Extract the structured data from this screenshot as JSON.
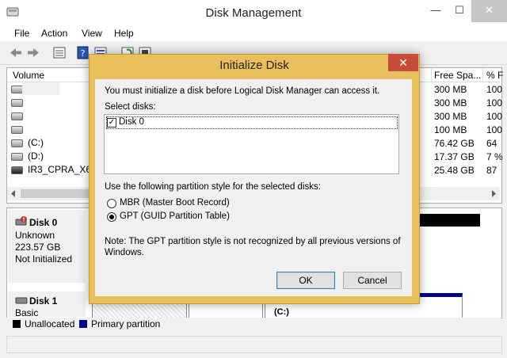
{
  "window": {
    "title": "Disk Management",
    "minimize": "—",
    "maximize": "☐",
    "close": "✕"
  },
  "menu": [
    "File",
    "Action",
    "View",
    "Help"
  ],
  "toolbar_icons": [
    "back-arrow-icon",
    "forward-arrow-icon",
    "properties-icon",
    "help-icon",
    "refresh-icon",
    "rescan-icon"
  ],
  "volume_list": {
    "columns": [
      "Volume",
      "Free Spa...",
      "% F"
    ],
    "rows": [
      {
        "volume": "",
        "free": "300 MB",
        "pct": "100"
      },
      {
        "volume": "",
        "free": "300 MB",
        "pct": "100"
      },
      {
        "volume": "",
        "free": "300 MB",
        "pct": "100"
      },
      {
        "volume": "",
        "free": "100 MB",
        "pct": "100"
      },
      {
        "volume": "(C:)",
        "free": "76.42 GB",
        "pct": "64"
      },
      {
        "volume": "(D:)",
        "free": "17.37 GB",
        "pct": "7 %"
      },
      {
        "volume": "IR3_CPRA_X6 (E",
        "free": "25.48 GB",
        "pct": "87"
      }
    ]
  },
  "graphical": {
    "disk0": {
      "name": "Disk 0",
      "type": "Unknown",
      "size": "223.57 GB",
      "status": "Not Initialized"
    },
    "disk1": {
      "name": "Disk 1",
      "type": "Basic",
      "partition_label": "(C:)"
    }
  },
  "legend": [
    {
      "label": "Unallocated",
      "color": "#000000"
    },
    {
      "label": "Primary partition",
      "color": "#00008b"
    }
  ],
  "dialog": {
    "title": "Initialize Disk",
    "close": "✕",
    "intro": "You must initialize a disk before Logical Disk Manager can access it.",
    "select_label": "Select disks:",
    "disks": [
      {
        "label": "Disk 0",
        "checked": true
      }
    ],
    "style_label": "Use the following partition style for the selected disks:",
    "options": [
      {
        "label": "MBR (Master Boot Record)",
        "selected": false
      },
      {
        "label": "GPT (GUID Partition Table)",
        "selected": true
      }
    ],
    "note_line1": "Note: The GPT partition style is not recognized by all previous versions of",
    "note_line2": "Windows.",
    "ok": "OK",
    "cancel": "Cancel"
  }
}
